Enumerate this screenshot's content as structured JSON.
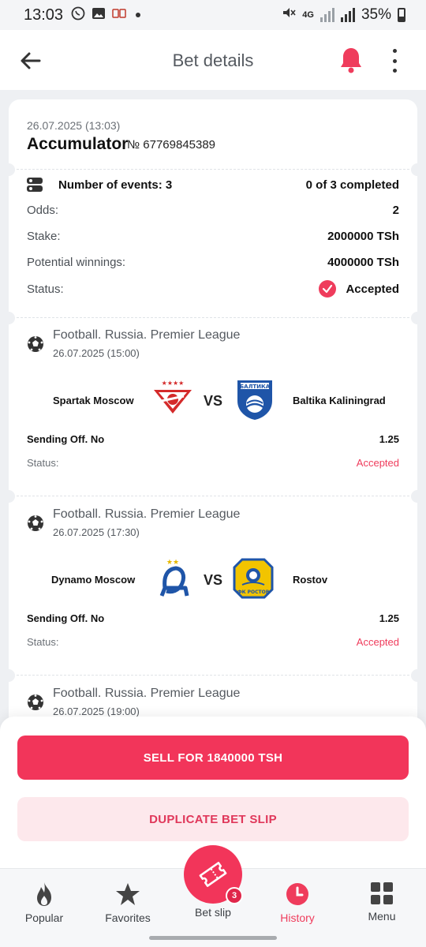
{
  "status_bar": {
    "time": "13:03",
    "network": "4G",
    "battery": "35%"
  },
  "appbar": {
    "title": "Bet details"
  },
  "bet": {
    "date": "26.07.2025 (13:03)",
    "type": "Accumulator",
    "number": "№ 67769845389",
    "events_label": "Number of events: 3",
    "completed": "0 of 3 completed",
    "odds_label": "Odds:",
    "odds_value": "2",
    "stake_label": "Stake:",
    "stake_value": "2000000 TSh",
    "winnings_label": "Potential winnings:",
    "winnings_value": "4000000 TSh",
    "status_label": "Status:",
    "status_value": "Accepted"
  },
  "events": [
    {
      "league": "Football. Russia. Premier League",
      "date": "26.07.2025 (15:00)",
      "home": "Spartak Moscow",
      "vs": "VS",
      "away": "Baltika Kaliningrad",
      "market": "Sending Off. No",
      "odd": "1.25",
      "status_label": "Status:",
      "status_value": "Accepted"
    },
    {
      "league": "Football. Russia. Premier League",
      "date": "26.07.2025 (17:30)",
      "home": "Dynamo Moscow",
      "vs": "VS",
      "away": "Rostov",
      "market": "Sending Off. No",
      "odd": "1.25",
      "status_label": "Status:",
      "status_value": "Accepted"
    },
    {
      "league": "Football. Russia. Premier League",
      "date": "26.07.2025 (19:00)"
    }
  ],
  "actions": {
    "sell": "SELL FOR 1840000 TSH",
    "duplicate": "DUPLICATE BET SLIP"
  },
  "nav": {
    "popular": "Popular",
    "favorites": "Favorites",
    "betslip": "Bet slip",
    "betslip_count": "3",
    "history": "History",
    "menu": "Menu"
  },
  "colors": {
    "accent": "#ef3c5c",
    "button": "#f2355a",
    "button_light": "#fde8ec"
  }
}
